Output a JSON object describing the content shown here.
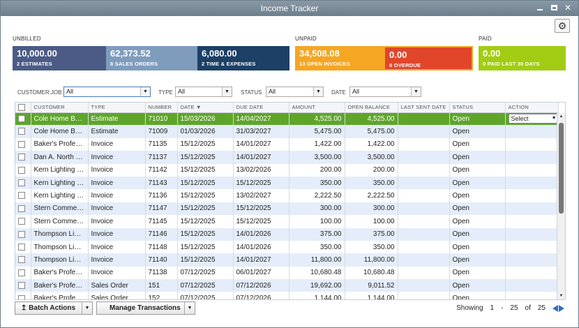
{
  "window": {
    "title": "Income Tracker"
  },
  "summary": {
    "unbilled_label": "UNBILLED",
    "unpaid_label": "UNPAID",
    "paid_label": "PAID",
    "tiles": [
      {
        "amount": "10,000.00",
        "caption": "2 ESTIMATES",
        "color": "#4b5b85"
      },
      {
        "amount": "62,373.52",
        "caption": "8 SALES ORDERS",
        "color": "#7f9cbd"
      },
      {
        "amount": "6,080.00",
        "caption": "2 TIME & EXPENSES",
        "color": "#1c4066"
      },
      {
        "amount": "34,508.08",
        "caption": "13 OPEN INVOICES",
        "color": "#f5a623"
      },
      {
        "amount": "0.00",
        "caption": "0 OVERDUE",
        "color": "#e1462a"
      },
      {
        "amount": "0.00",
        "caption": "0 PAID LAST 30 DAYS",
        "color": "#a2cc13"
      }
    ]
  },
  "filters": {
    "customer_label": "CUSTOMER:JOB",
    "customer_value": "All",
    "type_label": "TYPE",
    "type_value": "All",
    "status_label": "STATUS",
    "status_value": "All",
    "date_label": "DATE",
    "date_value": "All"
  },
  "table": {
    "headers": [
      "CUSTOMER",
      "TYPE",
      "NUMBER",
      "DATE",
      "DUE DATE",
      "AMOUNT",
      "OPEN BALANCE",
      "LAST SENT DATE",
      "STATUS",
      "ACTION"
    ],
    "sort_indicator": "▼",
    "action_select": "Select",
    "rows": [
      [
        "Cole Home Build...",
        "Estimate",
        "71010",
        "15/03/2026",
        "14/04/2027",
        "4,525.00",
        "4,525.00",
        "",
        "Open"
      ],
      [
        "Cole Home Build...",
        "Estimate",
        "71009",
        "01/03/2026",
        "31/03/2027",
        "5,475.00",
        "5,475.00",
        "",
        "Open"
      ],
      [
        "Baker's Professi...",
        "Invoice",
        "71135",
        "15/12/2025",
        "14/01/2027",
        "1,422.00",
        "1,422.00",
        "",
        "Open"
      ],
      [
        "Dan A. North Bui...",
        "Invoice",
        "71137",
        "15/12/2025",
        "14/01/2027",
        "3,500.00",
        "3,500.00",
        "",
        "Open"
      ],
      [
        "Kern Lighting W...",
        "Invoice",
        "71142",
        "15/12/2025",
        "13/02/2026",
        "200.00",
        "200.00",
        "",
        "Open"
      ],
      [
        "Kern Lighting W...",
        "Invoice",
        "71143",
        "15/12/2025",
        "15/12/2025",
        "350.00",
        "350.00",
        "",
        "Open"
      ],
      [
        "Kern Lighting W...",
        "Invoice",
        "71136",
        "15/12/2025",
        "13/02/2027",
        "2,222.50",
        "2,222.50",
        "",
        "Open"
      ],
      [
        "Stern Commerci...",
        "Invoice",
        "71147",
        "15/12/2025",
        "15/12/2025",
        "300.00",
        "300.00",
        "",
        "Open"
      ],
      [
        "Stern Commerci...",
        "Invoice",
        "71145",
        "15/12/2025",
        "15/12/2025",
        "100.00",
        "100.00",
        "",
        "Open"
      ],
      [
        "Thompson Lighti...",
        "Invoice",
        "71146",
        "15/12/2025",
        "14/01/2026",
        "375.00",
        "375.00",
        "",
        "Open"
      ],
      [
        "Thompson Lighti...",
        "Invoice",
        "71148",
        "15/12/2025",
        "14/01/2026",
        "350.00",
        "350.00",
        "",
        "Open"
      ],
      [
        "Thompson Lighti...",
        "Invoice",
        "71140",
        "15/12/2025",
        "14/01/2027",
        "11,800.00",
        "11,800.00",
        "",
        "Open"
      ],
      [
        "Baker's Professi...",
        "Invoice",
        "71138",
        "07/12/2025",
        "06/01/2027",
        "10,680.48",
        "10,680.48",
        "",
        "Open"
      ],
      [
        "Baker's Professi...",
        "Sales Order",
        "151",
        "07/12/2025",
        "07/12/2026",
        "19,692.00",
        "9,011.52",
        "",
        "Open"
      ],
      [
        "Baker's Professi...",
        "Sales Order",
        "152",
        "07/12/2025",
        "07/12/2026",
        "1,144.00",
        "1,144.00",
        "",
        "Open"
      ]
    ]
  },
  "footer": {
    "batch_actions": "Batch Actions",
    "manage_transactions": "Manage Transactions",
    "showing_label": "Showing",
    "range_start": "1",
    "range_sep": "-",
    "range_end": "25",
    "of_label": "of",
    "total": "25"
  }
}
